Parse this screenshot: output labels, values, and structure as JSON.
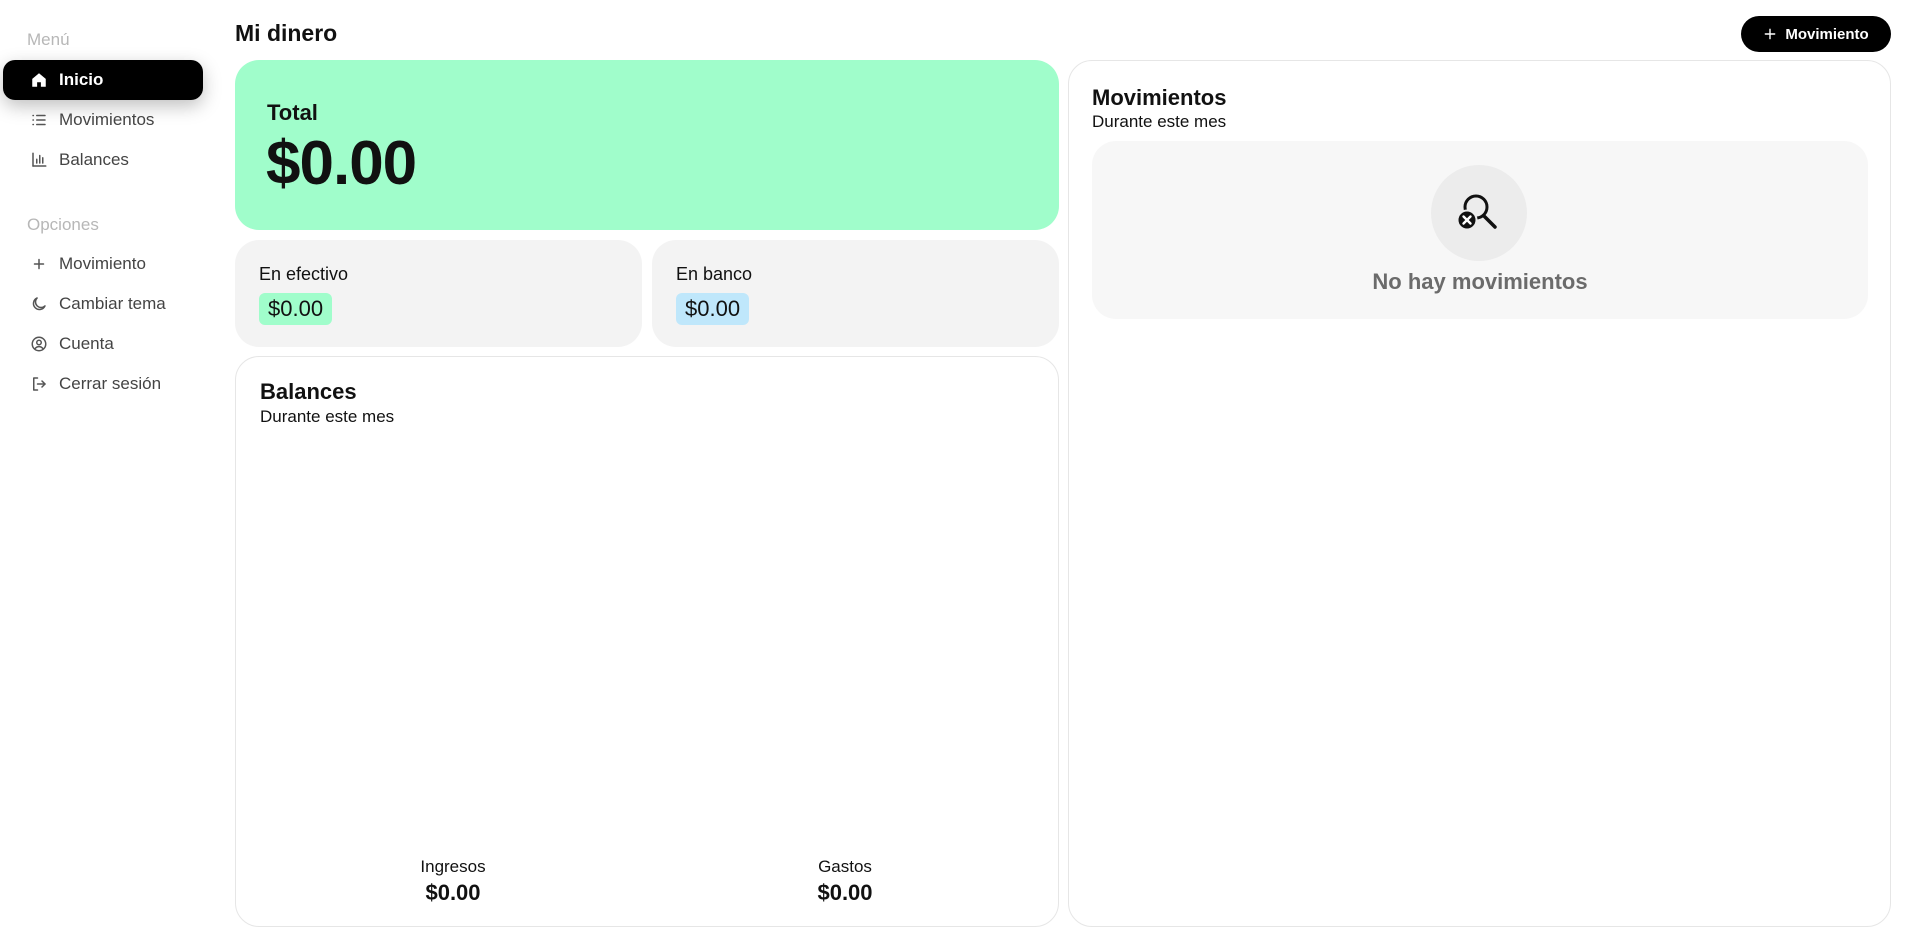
{
  "sidebar": {
    "menu_title": "Menú",
    "menu_items": [
      {
        "label": "Inicio",
        "icon": "home-icon",
        "active": true
      },
      {
        "label": "Movimientos",
        "icon": "list-icon",
        "active": false
      },
      {
        "label": "Balances",
        "icon": "bar-chart-icon",
        "active": false
      }
    ],
    "options_title": "Opciones",
    "option_items": [
      {
        "label": "Movimiento",
        "icon": "plus-icon"
      },
      {
        "label": "Cambiar tema",
        "icon": "moon-icon"
      },
      {
        "label": "Cuenta",
        "icon": "user-circle-icon"
      },
      {
        "label": "Cerrar sesión",
        "icon": "logout-icon"
      }
    ]
  },
  "header": {
    "title": "Mi dinero",
    "new_button_label": "Movimiento"
  },
  "summary": {
    "total_label": "Total",
    "total_value": "$0.00",
    "cash_label": "En efectivo",
    "cash_value": "$0.00",
    "bank_label": "En banco",
    "bank_value": "$0.00"
  },
  "balances": {
    "title": "Balances",
    "subtitle": "Durante este mes",
    "income_label": "Ingresos",
    "income_value": "$0.00",
    "expenses_label": "Gastos",
    "expenses_value": "$0.00"
  },
  "movements": {
    "title": "Movimientos",
    "subtitle": "Durante este mes",
    "empty_text": "No hay movimientos",
    "empty_icon": "search-x-icon"
  },
  "colors": {
    "accent_total": "#a0fdcb",
    "cash_pill": "#a0fdcb",
    "bank_pill": "#bfe7fb",
    "primary": "#000000"
  }
}
